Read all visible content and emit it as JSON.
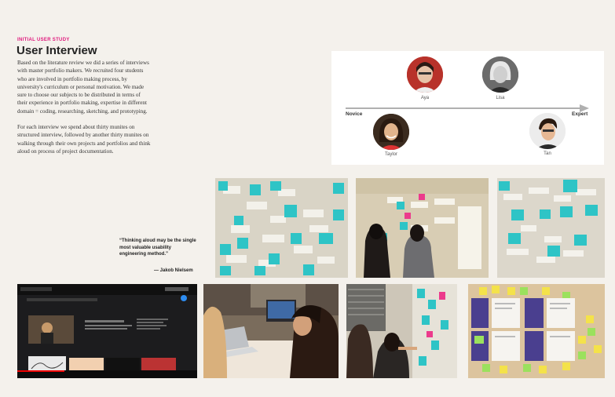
{
  "section": {
    "eyebrow": "INITIAL USER STUDY",
    "title": "User Interview",
    "paragraphs": [
      "Based on the literature review we did a series of interviews with master portfolio makers. We recruited four students who are involved in portfolio making process, by university's curriculum or personal motivation. We made sure to choose our subjects to be distributed in terms of their experience in portfolio making, expertise in different domain = coding, researching, sketching, and prototyping.",
      "For each interview we spend about thirty munites on structured interview, followed by another thirty munites on walking through their own projects and portfolios and think aloud on process of project documentation."
    ]
  },
  "quote": {
    "text": "“Thinking aloud may be the single most valuable usability engineering method.”",
    "attribution": "— Jakob Nielsem"
  },
  "spectrum": {
    "left_label": "Novice",
    "right_label": "Expert",
    "participants": [
      {
        "name": "Aya",
        "level": 0.35
      },
      {
        "name": "Lisa",
        "level": 0.62
      },
      {
        "name": "Taylor",
        "level": 0.18
      },
      {
        "name": "Tan",
        "level": 0.93
      }
    ]
  },
  "colors": {
    "background": "#f4f1ec",
    "accent": "#e0197d",
    "sticky_teal": "#2ec4c6",
    "sticky_pink": "#ec3a8c",
    "sticky_yellow": "#f4e24a",
    "sticky_green": "#9be15d"
  }
}
